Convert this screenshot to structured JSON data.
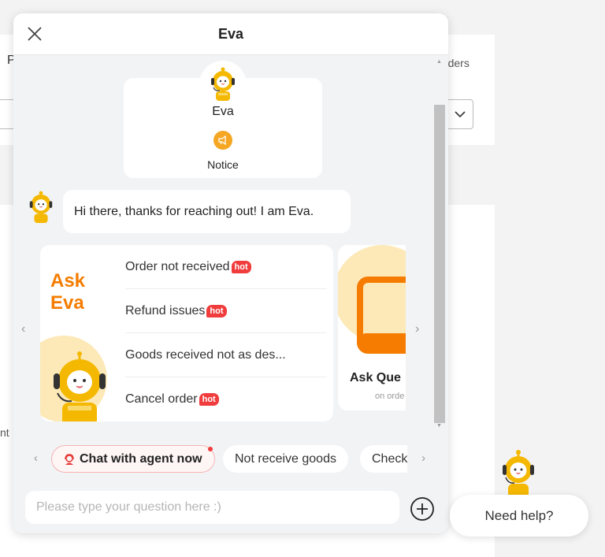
{
  "background": {
    "partial_label": "P",
    "orders_label": "rders",
    "partial_text": "nt"
  },
  "chat": {
    "title": "Eva",
    "close_icon": "close-icon",
    "profile": {
      "name": "Eva",
      "notice_label": "Notice",
      "notice_icon": "megaphone-icon"
    },
    "greeting": "Hi there, thanks for reaching out! I am Eva.",
    "carousel": {
      "card1": {
        "title_line1": "Ask",
        "title_line2": "Eva",
        "topics": [
          {
            "label": "Order not received",
            "badge": "hot"
          },
          {
            "label": "Refund issues",
            "badge": "hot"
          },
          {
            "label": "Goods received not as des...",
            "badge": ""
          },
          {
            "label": "Cancel order",
            "badge": "hot"
          }
        ]
      },
      "card2": {
        "title": "Ask Que",
        "subtitle": "on orde"
      }
    },
    "quick_replies": [
      {
        "label": "Chat with agent now",
        "icon": "agent-headset-icon",
        "has_dot": true
      },
      {
        "label": "Not receive goods"
      },
      {
        "label": "Check"
      }
    ],
    "input": {
      "placeholder": "Please type your question here :)",
      "value": ""
    }
  },
  "help": {
    "label": "Need help?"
  },
  "colors": {
    "accent": "#f57c00",
    "robot_yellow": "#f5b800",
    "hot_red": "#f03c3c"
  }
}
